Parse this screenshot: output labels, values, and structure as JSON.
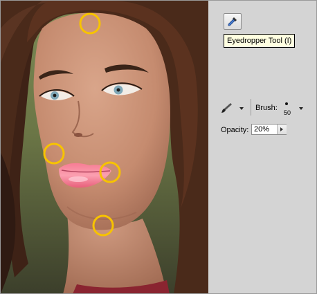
{
  "tooltip": {
    "text": "Eyedropper Tool (I)"
  },
  "tool_options": {
    "brush_label": "Brush:",
    "brush_size": "50",
    "opacity_label": "Opacity:",
    "opacity_value": "20%"
  },
  "markers": [
    {
      "name": "forehead-sample-marker"
    },
    {
      "name": "cheek-sample-marker"
    },
    {
      "name": "lip-corner-sample-marker"
    },
    {
      "name": "chin-sample-marker"
    }
  ],
  "colors": {
    "marker": "#f7c300",
    "panel_background": "#d4d4d4",
    "tooltip_background": "#ffffe1",
    "lip_highlight": "#f66f8a"
  },
  "icons": [
    "eyedropper-icon",
    "brush-icon",
    "brush-preset-dot-icon",
    "dropdown-arrow-icon",
    "increment-arrow-icon"
  ]
}
